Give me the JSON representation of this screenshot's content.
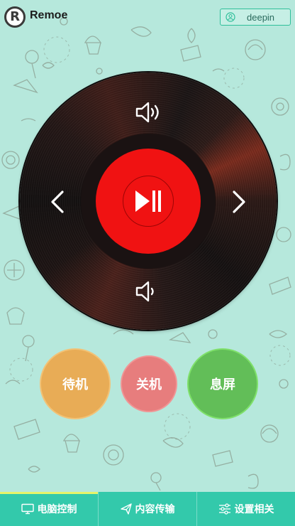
{
  "header": {
    "logo_letter": "R",
    "app_title": "Remoe",
    "user_name": "deepin",
    "user_icon": "person-circle-icon"
  },
  "player": {
    "volume_up_icon": "volume-up-icon",
    "volume_down_icon": "volume-down-icon",
    "prev_icon": "chevron-left-icon",
    "next_icon": "chevron-right-icon",
    "play_pause_icon": "play-pause-icon"
  },
  "actions": {
    "standby_label": "待机",
    "shutdown_label": "关机",
    "screen_off_label": "息屏"
  },
  "bottom_nav": {
    "tabs": [
      {
        "label": "电脑控制",
        "icon": "monitor-icon",
        "active": true
      },
      {
        "label": "内容传输",
        "icon": "send-icon",
        "active": false
      },
      {
        "label": "设置相关",
        "icon": "sliders-icon",
        "active": false
      }
    ]
  },
  "colors": {
    "background": "#b6e8dc",
    "accent": "#33c9ab",
    "record_label": "#f01212",
    "standby": "#e8ac56",
    "shutdown": "#e77d7d",
    "screen_off": "#62be58",
    "active_tab_indicator": "#e6f46a"
  }
}
